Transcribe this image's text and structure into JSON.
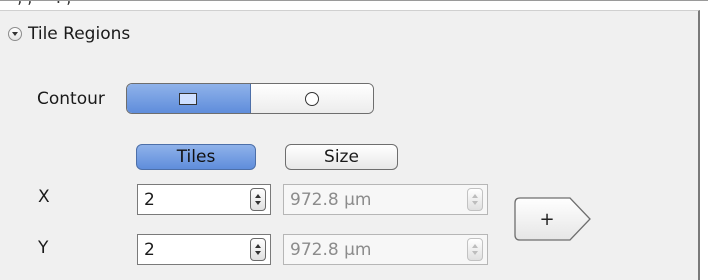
{
  "section": {
    "title": "Tile Regions",
    "icon": "collapse-arrow-icon"
  },
  "contour": {
    "label": "Contour",
    "options": [
      {
        "icon": "rectangle-icon",
        "selected": true
      },
      {
        "icon": "circle-icon",
        "selected": false
      }
    ]
  },
  "mode": {
    "tiles_label": "Tiles",
    "size_label": "Size",
    "selected": "Tiles"
  },
  "x": {
    "label": "X",
    "tiles": "2",
    "size": "972.8 µm"
  },
  "y": {
    "label": "Y",
    "tiles": "2",
    "size": "972.8 µm"
  },
  "add_button": {
    "label": "+"
  },
  "colors": {
    "accent": "#6f99e1",
    "panel": "#f0f0f0"
  }
}
